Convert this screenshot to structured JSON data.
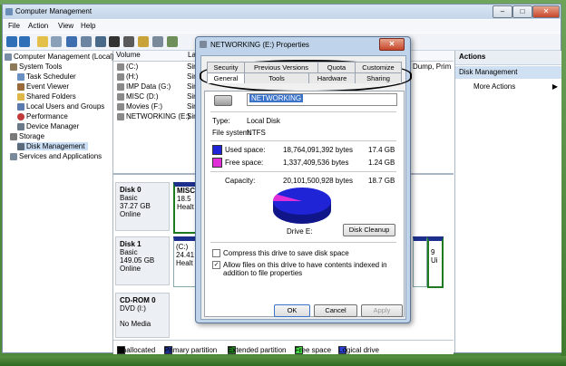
{
  "window": {
    "title": "Computer Management",
    "min": "–",
    "max": "□",
    "close": "✕"
  },
  "menu": [
    "File",
    "Action",
    "View",
    "Help"
  ],
  "tree": {
    "root": "Computer Management (Local)",
    "system_tools": "System Tools",
    "items": [
      "Task Scheduler",
      "Event Viewer",
      "Shared Folders",
      "Local Users and Groups",
      "Performance",
      "Device Manager"
    ],
    "storage": "Storage",
    "disk_management": "Disk Management",
    "services": "Services and Applications"
  },
  "volumes": {
    "headers": [
      "Volume",
      "Lay"
    ],
    "rows": [
      {
        "name": "(C:)",
        "layout": "Sim"
      },
      {
        "name": "(H:)",
        "layout": "Sim"
      },
      {
        "name": "IMP Data (G:)",
        "layout": "Sim"
      },
      {
        "name": "MISC (D:)",
        "layout": "Sim"
      },
      {
        "name": "Movies (F:)",
        "layout": "Sim"
      },
      {
        "name": "NETWORKING (E:)",
        "layout": "Sim"
      }
    ],
    "right_fragment": "Dump, Prim"
  },
  "disks": [
    {
      "name": "Disk 0",
      "type": "Basic",
      "size": "37.27 GB",
      "status": "Online",
      "part_label": "MISC",
      "part_size": "18.5",
      "part_status": "Healt"
    },
    {
      "name": "Disk 1",
      "type": "Basic",
      "size": "149.05 GB",
      "status": "Online",
      "part_label": "(C:)",
      "part_size": "24.41",
      "part_status": "Healt",
      "right_a": "9",
      "right_b": "Ui"
    },
    {
      "name": "CD-ROM 0",
      "type": "DVD (I:)",
      "size": "",
      "status": "No Media"
    }
  ],
  "legend": [
    {
      "label": "Unallocated",
      "color": "#000000"
    },
    {
      "label": "Primary partition",
      "color": "#1c2f8c"
    },
    {
      "label": "Extended partition",
      "color": "#1f7a1f"
    },
    {
      "label": "Free space",
      "color": "#42d442"
    },
    {
      "label": "Logical drive",
      "color": "#2b3fd6"
    }
  ],
  "actions": {
    "header": "Actions",
    "section": "Disk Management",
    "more": "More Actions"
  },
  "dialog": {
    "title": "NETWORKING (E:) Properties",
    "close": "✕",
    "tabs_row1": [
      "Security",
      "Previous Versions",
      "Quota",
      "Customize"
    ],
    "tabs_row2": [
      "General",
      "Tools",
      "Hardware",
      "Sharing"
    ],
    "label_value": "NETWORKING",
    "type_label": "Type:",
    "type_value": "Local Disk",
    "fs_label": "File system:",
    "fs_value": "NTFS",
    "used_label": "Used space:",
    "used_bytes": "18,764,091,392 bytes",
    "used_gb": "17.4 GB",
    "free_label": "Free space:",
    "free_bytes": "1,337,409,536 bytes",
    "free_gb": "1.24 GB",
    "cap_label": "Capacity:",
    "cap_bytes": "20,101,500,928 bytes",
    "cap_gb": "18.7 GB",
    "drive_label": "Drive E:",
    "cleanup": "Disk Cleanup",
    "compress": "Compress this drive to save disk space",
    "index": "Allow files on this drive to have contents indexed in addition to file properties",
    "ok": "OK",
    "cancel": "Cancel",
    "apply": "Apply",
    "used_color": "#1f24d6",
    "free_color": "#e02fd8"
  }
}
